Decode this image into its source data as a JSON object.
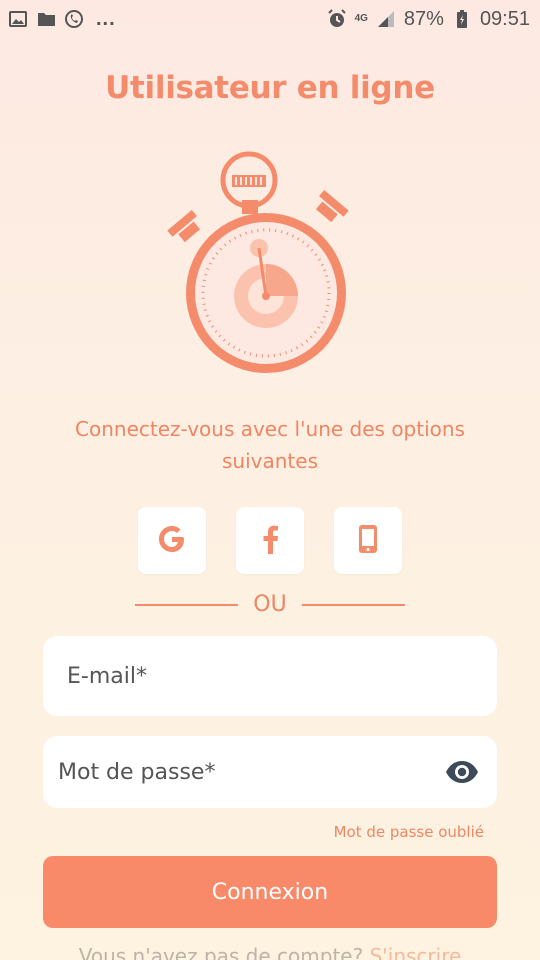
{
  "status_bar": {
    "dots": "...",
    "network": "4G",
    "battery": "87%",
    "time": "09:51"
  },
  "title": "Utilisateur en ligne",
  "subtitle": "Connectez-vous avec l'une des options suivantes",
  "social_buttons": [
    {
      "icon": "google-icon"
    },
    {
      "icon": "facebook-icon"
    },
    {
      "icon": "phone-icon"
    }
  ],
  "divider_text": "OU",
  "email": {
    "placeholder": "E-mail*",
    "value": ""
  },
  "password": {
    "placeholder": "Mot de passe*",
    "value": ""
  },
  "forgot_password": "Mot de passe oublié",
  "login_button": "Connexion",
  "signup": {
    "prompt": "Vous n'avez pas de compte?",
    "link": "S'inscrire"
  },
  "colors": {
    "accent": "#f88a69",
    "accent_text": "#f08562",
    "background": "#fdeee3"
  }
}
